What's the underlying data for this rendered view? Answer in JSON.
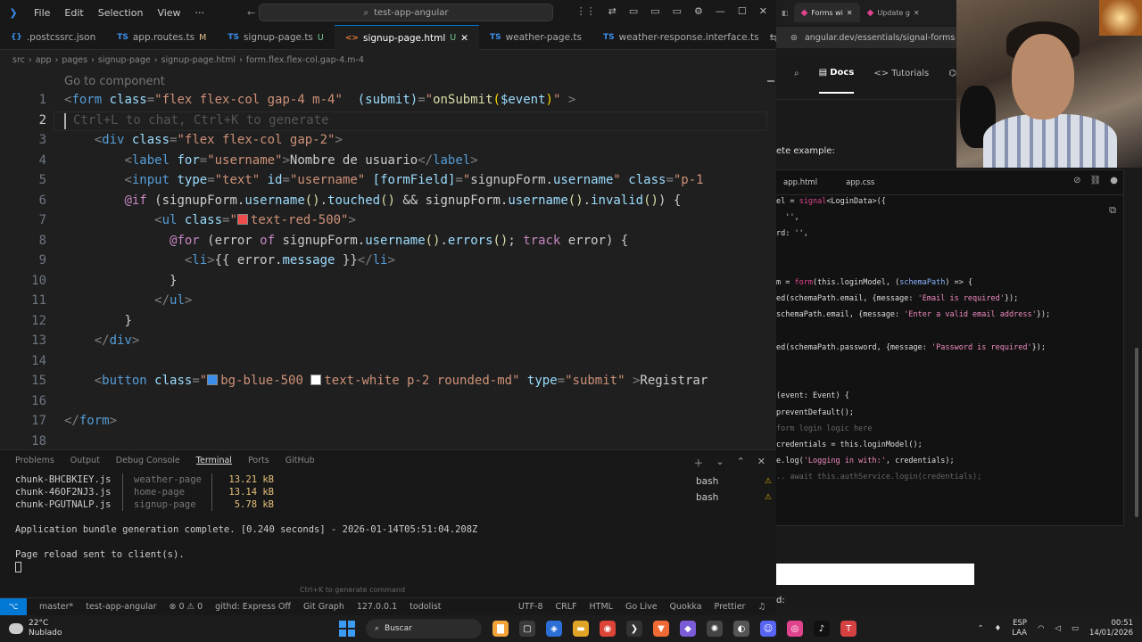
{
  "vscode": {
    "menu": [
      "File",
      "Edit",
      "Selection",
      "View",
      "···"
    ],
    "command_center": "test-app-angular",
    "tabs": [
      {
        "label": ".postcssrc.json",
        "icon": "{}",
        "badge": ""
      },
      {
        "label": "app.routes.ts",
        "icon": "TS",
        "badge": "M"
      },
      {
        "label": "signup-page.ts",
        "icon": "TS",
        "badge": "U"
      },
      {
        "label": "signup-page.html",
        "icon": "<>",
        "badge": "U",
        "active": true
      },
      {
        "label": "weather-page.ts",
        "icon": "TS",
        "badge": ""
      },
      {
        "label": "weather-response.interface.ts",
        "icon": "TS",
        "badge": ""
      }
    ],
    "breadcrumb": [
      "src",
      "app",
      "pages",
      "signup-page",
      "signup-page.html",
      "form.flex.flex-col.gap-4.m-4"
    ],
    "codelens": "Go to component",
    "ghost_hint": "Ctrl+L to chat, Ctrl+K to generate",
    "line_numbers": [
      "1",
      "2",
      "3",
      "4",
      "5",
      "6",
      "7",
      "8",
      "9",
      "10",
      "11",
      "12",
      "13",
      "14",
      "15",
      "16",
      "17",
      "18"
    ],
    "panel_tabs": [
      "Problems",
      "Output",
      "Debug Console",
      "Terminal",
      "Ports",
      "GitHub"
    ],
    "terminal_rows": [
      {
        "file": "chunk-BHCBKIEY.js",
        "name": "weather-page",
        "size": "13.21 kB"
      },
      {
        "file": "chunk-46OF2NJ3.js",
        "name": "home-page",
        "size": "13.14 kB"
      },
      {
        "file": "chunk-PGUTNALP.js",
        "name": "signup-page",
        "size": "5.78 kB"
      }
    ],
    "terminal_lines": [
      "Application bundle generation complete. [0.240 seconds] - 2026-01-14T05:51:04.208Z",
      "Page reload sent to client(s)."
    ],
    "shells": [
      "bash",
      "bash"
    ],
    "cmd_hint": "Ctrl+K to generate command",
    "status_left": [
      "master*",
      "test-app-angular",
      "⊗ 0 ⚠ 0",
      "githd: Express Off",
      "Git Graph",
      "127.0.0.1",
      "todolist"
    ],
    "status_right": [
      "UTF-8",
      "CRLF",
      "HTML",
      "Go Live",
      "Quokka",
      "Prettier"
    ]
  },
  "browser": {
    "tabs": [
      "Forms wi",
      "Update g"
    ],
    "url": "angular.dev/essentials/signal-forms",
    "nav": [
      "Docs",
      "Tutorials",
      "P"
    ],
    "text_example": "ete example:",
    "code_tabs": [
      "app.html",
      "app.css"
    ],
    "bottom_text": "d:"
  },
  "taskbar": {
    "temp": "22°C",
    "weather": "Nublado",
    "search": "Buscar",
    "lang1": "ESP",
    "lang2": "LAA",
    "time": "00:51",
    "date": "14/01/2026"
  }
}
